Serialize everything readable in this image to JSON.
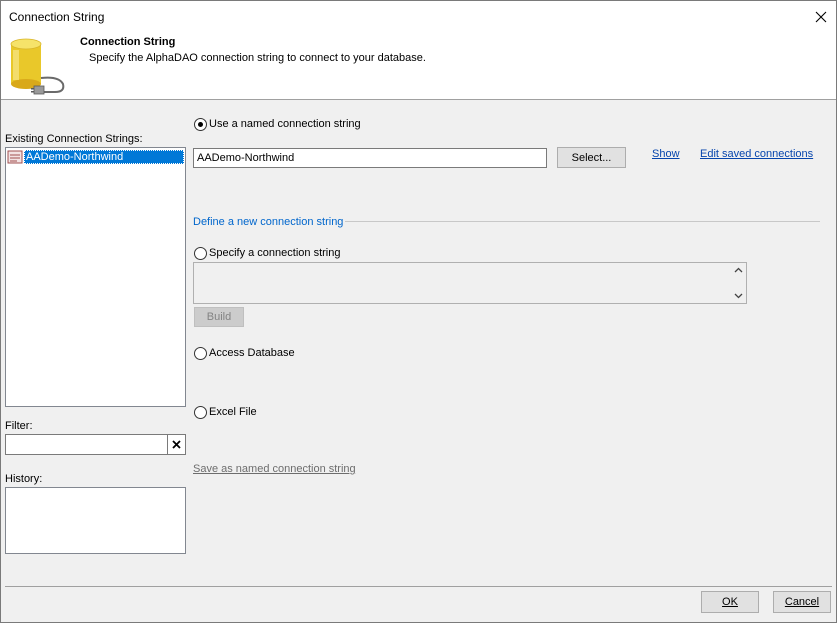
{
  "window": {
    "title": "Connection String"
  },
  "header": {
    "title": "Connection String",
    "description": "Specify the AlphaDAO connection string to connect to your database."
  },
  "left": {
    "existing_label": "Existing Connection Strings:",
    "items": [
      {
        "label": "AADemo-Northwind",
        "selected": true
      }
    ],
    "filter_label": "Filter:",
    "filter_value": "",
    "history_label": "History:"
  },
  "named": {
    "radio_label": "Use a named connection string",
    "value": "AADemo-Northwind",
    "select_button": "Select...",
    "show_link": "Show",
    "edit_link": "Edit saved connections"
  },
  "define_group": {
    "label": "Define a new connection string",
    "specify_label": "Specify a connection string",
    "specify_value": "",
    "build_button": "Build",
    "access_label": "Access Database",
    "excel_label": "Excel File",
    "save_link": "Save as named connection string"
  },
  "footer": {
    "ok_label": "OK",
    "cancel_label": "Cancel"
  },
  "colors": {
    "selection": "#0078d7",
    "link": "#0645ad",
    "group_label": "#0066cc"
  }
}
